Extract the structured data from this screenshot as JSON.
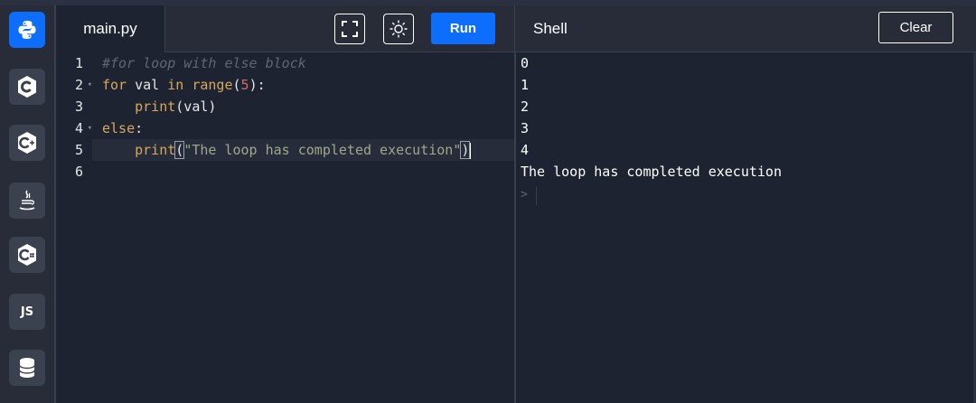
{
  "sidebar": {
    "items": [
      {
        "name": "python-icon",
        "active": true
      },
      {
        "name": "c-icon"
      },
      {
        "name": "cpp-icon"
      },
      {
        "name": "java-icon"
      },
      {
        "name": "csharp-icon"
      },
      {
        "name": "js-icon",
        "label": "JS"
      },
      {
        "name": "database-icon"
      }
    ]
  },
  "header": {
    "file_tab": "main.py",
    "fullscreen_icon": "fullscreen-icon",
    "theme_icon": "sun-icon",
    "run_label": "Run",
    "shell_title": "Shell",
    "clear_label": "Clear"
  },
  "editor": {
    "line_numbers": [
      "1",
      "2",
      "3",
      "4",
      "5",
      "6"
    ],
    "lines": [
      {
        "comment": "#for loop with else block"
      },
      {
        "kw": "for",
        "text1": " val ",
        "kw2": "in",
        "fn": "range",
        "paren_open": "(",
        "num": "5",
        "paren_close": "):"
      },
      {
        "indent": "    ",
        "fn": "print",
        "rest": "(val)"
      },
      {
        "kw": "else",
        "rest": ":"
      },
      {
        "indent": "    ",
        "fn": "print",
        "paren_open": "(",
        "str": "\"The loop has completed execution\"",
        "paren_close": ")"
      },
      {
        "text": ""
      }
    ]
  },
  "shell": {
    "output": [
      "0",
      "1",
      "2",
      "3",
      "4",
      "The loop has completed execution"
    ],
    "prompt": ">"
  },
  "colors": {
    "accent": "#0d6efd",
    "background": "#1d2331",
    "panel": "#272c38"
  }
}
